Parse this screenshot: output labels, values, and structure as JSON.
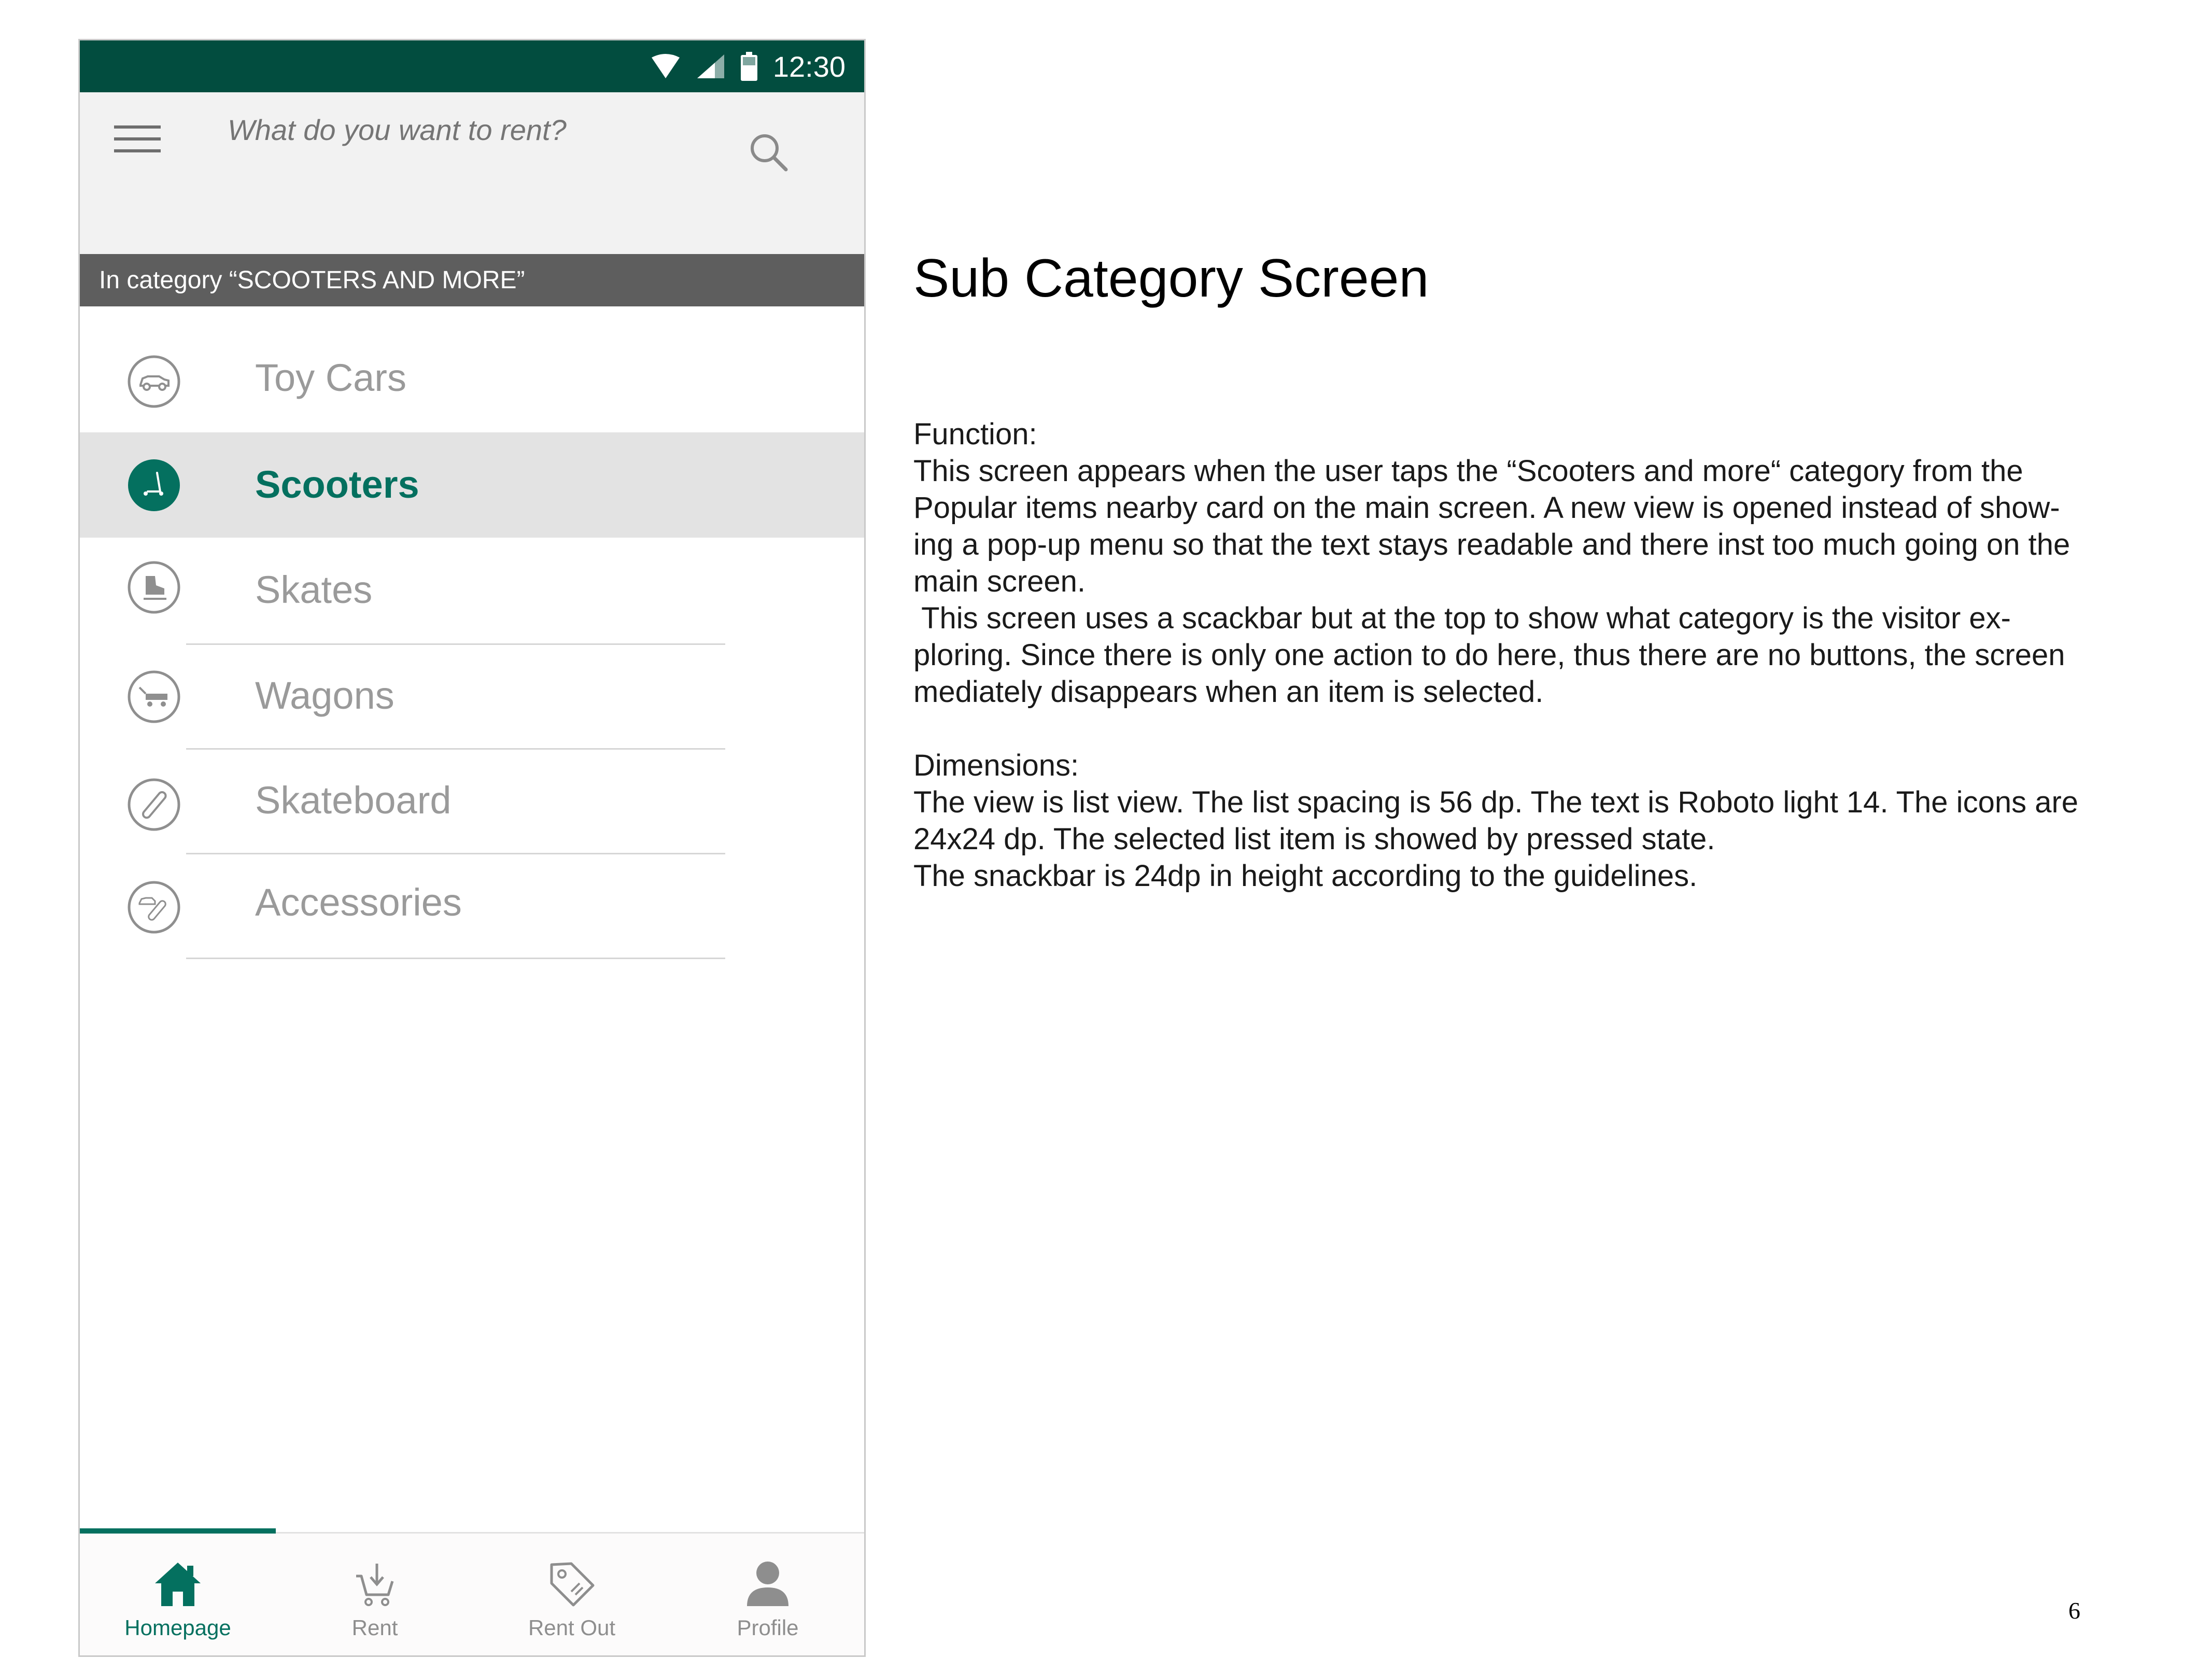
{
  "status_bar": {
    "time": "12:30",
    "background": "#024d3f"
  },
  "search": {
    "placeholder": "What do you want to rent?"
  },
  "category_bar": {
    "text": "In category “SCOOTERS AND MORE”"
  },
  "list": {
    "items": [
      {
        "label": "Toy Cars",
        "icon": "toy-car-icon",
        "selected": false
      },
      {
        "label": "Scooters",
        "icon": "scooter-icon",
        "selected": true
      },
      {
        "label": "Skates",
        "icon": "skate-icon",
        "selected": false
      },
      {
        "label": "Wagons",
        "icon": "wagon-icon",
        "selected": false
      },
      {
        "label": "Skateboard",
        "icon": "skateboard-icon",
        "selected": false
      },
      {
        "label": "Accessories",
        "icon": "accessories-icon",
        "selected": false
      }
    ]
  },
  "bottom_nav": {
    "items": [
      {
        "label": "Homepage",
        "icon": "home-icon",
        "active": true
      },
      {
        "label": "Rent",
        "icon": "cart-icon",
        "active": false
      },
      {
        "label": "Rent Out",
        "icon": "tag-icon",
        "active": false
      },
      {
        "label": "Profile",
        "icon": "person-icon",
        "active": false
      }
    ]
  },
  "colors": {
    "accent": "#04705f",
    "category_bar": "#5e5e5e",
    "selected_row": "#e3e3e3"
  },
  "doc": {
    "title": "Sub Category Screen",
    "lines": [
      "Function:",
      "This screen appears when the user taps the “Scooters and more“ category from the",
      "Popular items nearby card on the main screen. A new view is opened instead of show-",
      "ing a pop-up menu so that the text stays readable and there inst too much going on the",
      "main screen.",
      " This screen uses a scackbar but at the top to show what category is the visitor ex-",
      "ploring. Since there is only one action to do here, thus there are no buttons, the screen",
      "mediately disappears when an item is selected.",
      "",
      "Dimensions:",
      "The view is list view. The list spacing is 56 dp. The text is Roboto light 14. The icons are",
      "24x24 dp. The selected list item is showed by pressed state.",
      "The snackbar is 24dp in height according to the guidelines."
    ],
    "page_number": "6"
  }
}
